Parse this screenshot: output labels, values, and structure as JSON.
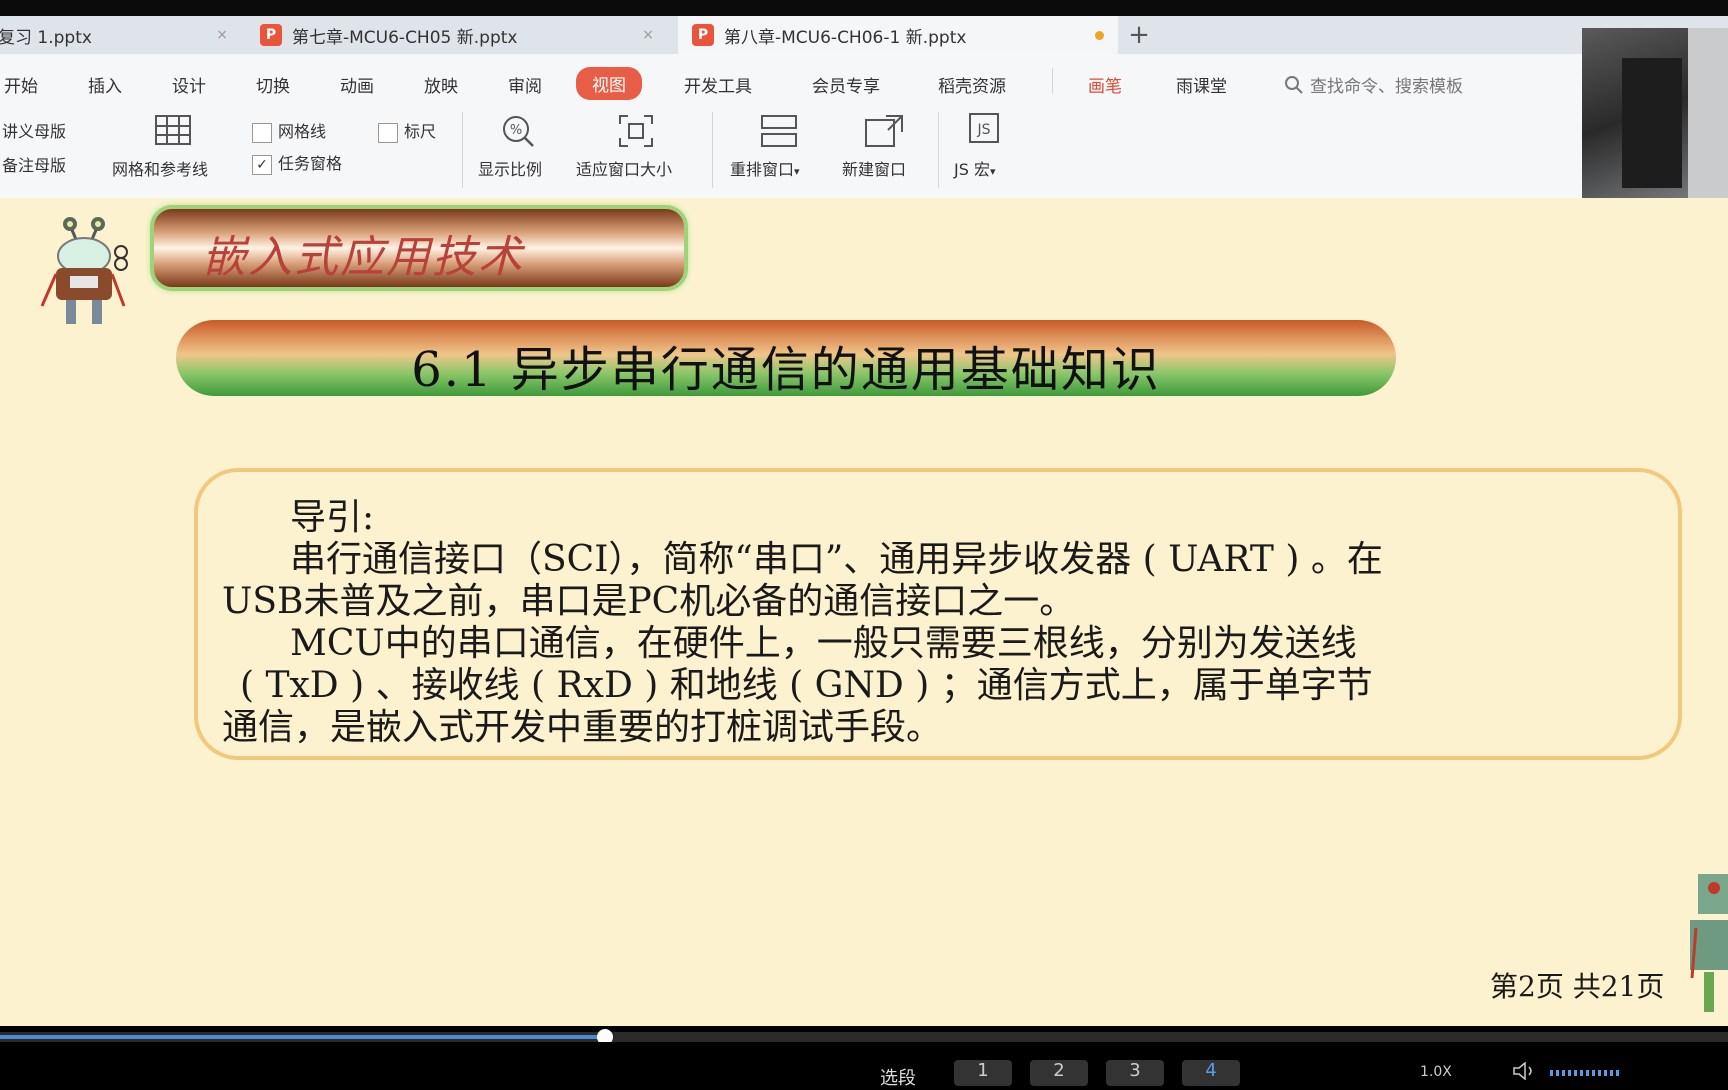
{
  "tabs": [
    {
      "label": "复习 1.pptx",
      "active": false
    },
    {
      "label": "第七章-MCU6-CH05 新.pptx",
      "active": false
    },
    {
      "label": "第八章-MCU6-CH06-1 新.pptx",
      "active": true
    }
  ],
  "add_tab": "+",
  "menu": [
    "开始",
    "插入",
    "设计",
    "切换",
    "动画",
    "放映",
    "审阅",
    "视图",
    "开发工具",
    "会员专享",
    "稻壳资源",
    "画笔",
    "雨课堂"
  ],
  "search_placeholder": "查找命令、搜索模板",
  "ribbon": {
    "handout_master": "讲义母版",
    "notes_master": "备注母版",
    "grid_guides": "网格和参考线",
    "gridlines": "网格线",
    "ruler": "标尺",
    "task_pane": "任务窗格",
    "zoom": "显示比例",
    "fit_window": "适应窗口大小",
    "arrange": "重排窗口",
    "new_window": "新建窗口",
    "js_macro": "JS 宏"
  },
  "slide": {
    "brand": "嵌入式应用技术",
    "title": "6.1  异步串行通信的通用基础知识",
    "lines": [
      "导引:",
      "串行通信接口（SCI），简称“串口”、通用异步收发器 ( UART ) 。在",
      "USB未普及之前，串口是PC机必备的通信接口之一。",
      "MCU中的串口通信，在硬件上，一般只需要三根线，分别为发送线",
      "( TxD ) 、接收线 ( RxD ) 和地线 ( GND ) ；通信方式上，属于单字节",
      "通信，是嵌入式开发中重要的打桩调试手段。"
    ],
    "page": "第2页  共21页"
  },
  "player": {
    "progress": 0.35,
    "select_label": "选段",
    "episodes": [
      "1",
      "2",
      "3",
      "4"
    ],
    "speed": "1.0X"
  },
  "colors": {
    "menu_active": "#e85d45",
    "slide_bg": "#fdf2cf",
    "box_border": "#f2c97c",
    "brand_text": "#b8413a"
  }
}
